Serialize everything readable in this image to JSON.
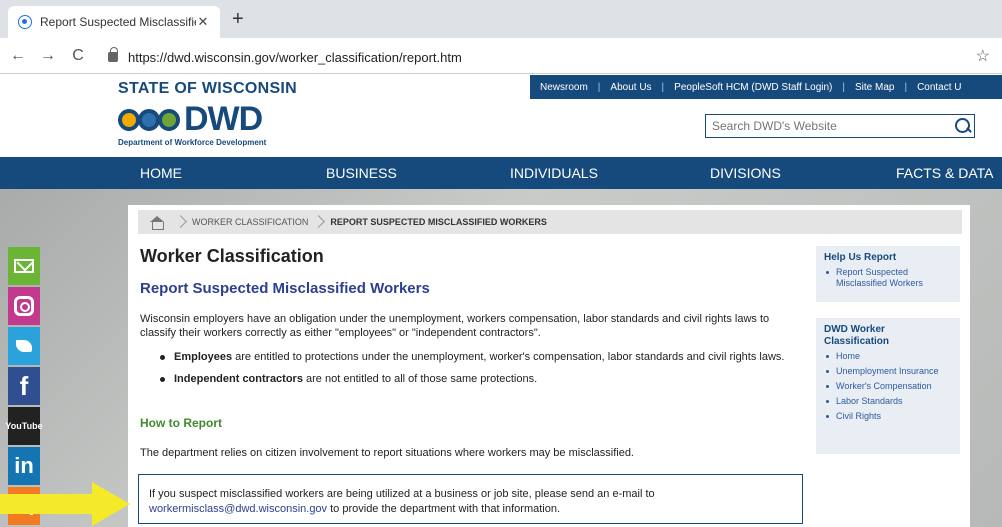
{
  "browser": {
    "tab_title": "Report Suspected Misclassified W",
    "tab_close": "✕",
    "new_tab": "+",
    "back": "←",
    "forward": "→",
    "reload": "C",
    "url": "https://dwd.wisconsin.gov/worker_classification/report.htm",
    "star": "☆"
  },
  "header": {
    "state_name": "STATE OF WISCONSIN",
    "logo_text": "DWD",
    "logo_subtitle": "Department of Workforce Development",
    "top_links": [
      "Newsroom",
      "About Us",
      "PeopleSoft HCM (DWD Staff Login)",
      "Site Map",
      "Contact U"
    ],
    "search_placeholder": "Search DWD's Website"
  },
  "main_nav": [
    "HOME",
    "BUSINESS",
    "INDIVIDUALS",
    "DIVISIONS",
    "FACTS & DATA"
  ],
  "breadcrumb": {
    "items": [
      "WORKER CLASSIFICATION",
      "REPORT SUSPECTED MISCLASSIFIED WORKERS"
    ]
  },
  "content": {
    "title": "Worker Classification",
    "subtitle": "Report Suspected Misclassified Workers",
    "intro": "Wisconsin employers have an obligation under the unemployment, workers compensation, labor standards and civil rights laws to classify their workers correctly as either \"employees\" or \"independent contractors\".",
    "bullets": [
      {
        "term": "Employees",
        "text": " are entitled to protections under the unemployment, worker's compensation, labor standards and civil rights laws."
      },
      {
        "term": "Independent contractors",
        "text": " are not entitled to all of those same protections."
      }
    ],
    "how_title": "How to Report",
    "relies": "The department relies on citizen involvement to report situations where workers may be misclassified.",
    "callout_text": "If you suspect misclassified workers are being utilized at a business or job site, please send an e-mail to",
    "callout_email": "workermisclass@dwd.wisconsin.gov",
    "callout_suffix": " to provide the department with that information."
  },
  "sidebar": {
    "help_title": "Help Us Report",
    "help_items": [
      "Report Suspected Misclassified Workers"
    ],
    "dwd_title": "DWD Worker Classification",
    "dwd_items": [
      "Home",
      "Unemployment Insurance",
      "Worker's Compensation",
      "Labor Standards",
      "Civil Rights"
    ]
  },
  "social": {
    "facebook": "f",
    "youtube": "YouTube",
    "linkedin": "in"
  },
  "colors": {
    "brand_blue": "#174a7c",
    "link_blue": "#2d3f8f",
    "green_heading": "#3f8a2f",
    "arrow_yellow": "#f4ea2a"
  }
}
